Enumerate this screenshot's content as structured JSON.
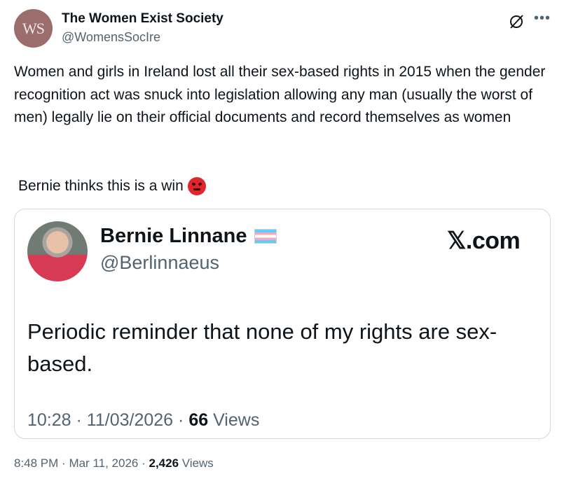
{
  "author": {
    "avatar_text": "WS",
    "name": "The Women Exist Society",
    "handle": "@WomensSocIre"
  },
  "icons": {
    "grok": "grok-icon",
    "more": "more-icon"
  },
  "tweet": {
    "text": "Women and girls in Ireland lost all their sex-based rights in 2015 when the gender recognition act was snuck into legislation allowing any man (usually the worst of men) legally lie on their official documents and record themselves as women",
    "extra_line": "Bernie thinks this is a win",
    "emoji": "angry-face"
  },
  "card": {
    "name": "Bernie Linnane",
    "flag": "transgender-flag",
    "handle": "@Berlinnaeus",
    "brand": "𝕏.com",
    "text": "Periodic reminder that none of my rights are sex-based.",
    "time": "10:28",
    "date": "11/03/2026",
    "views_count": "66",
    "views_label": "Views"
  },
  "footer": {
    "time": "8:48 PM",
    "date": "Mar 11, 2026",
    "views_count": "2,426",
    "views_label": "Views"
  },
  "colors": {
    "secondary_text": "#536471",
    "border": "#cfd9de",
    "avatar_bg": "#9b6d6d"
  }
}
